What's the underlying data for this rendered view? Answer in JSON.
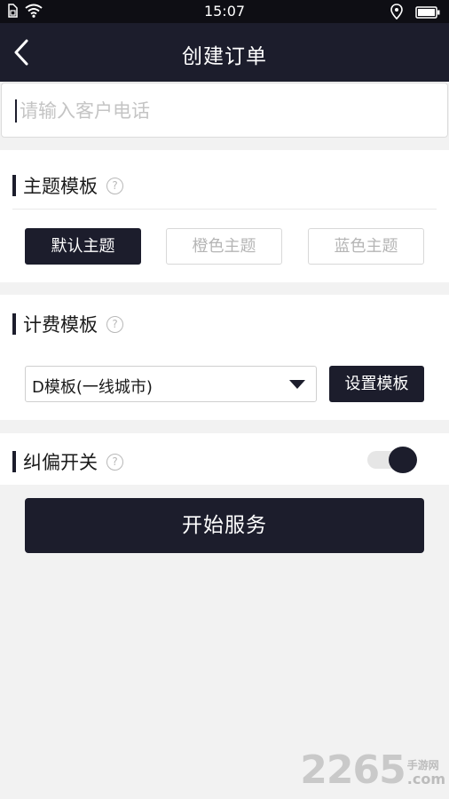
{
  "status_bar": {
    "time": "15:07",
    "icons": [
      "sim-icon",
      "wifi-icon",
      "location-icon",
      "battery-icon"
    ]
  },
  "nav": {
    "title": "创建订单",
    "back_icon": "chevron-left-icon"
  },
  "phone": {
    "placeholder": "请输入客户电话",
    "value": ""
  },
  "theme_section": {
    "title": "主题模板",
    "help_icon": "question-circle-icon",
    "options": [
      "默认主题",
      "橙色主题",
      "蓝色主题"
    ],
    "selected_index": 0
  },
  "pricing_section": {
    "title": "计费模板",
    "help_icon": "question-circle-icon",
    "selected": "D模板(一线城市)",
    "set_button": "设置模板"
  },
  "correction_section": {
    "title": "纠偏开关",
    "help_icon": "question-circle-icon",
    "enabled": true
  },
  "start_button": "开始服务",
  "watermark": {
    "number": "2265",
    "cn": "手游网",
    "com": ".com"
  },
  "colors": {
    "primary": "#1c1d2c",
    "status_bar": "#0e0e14",
    "background": "#f2f2f2"
  }
}
